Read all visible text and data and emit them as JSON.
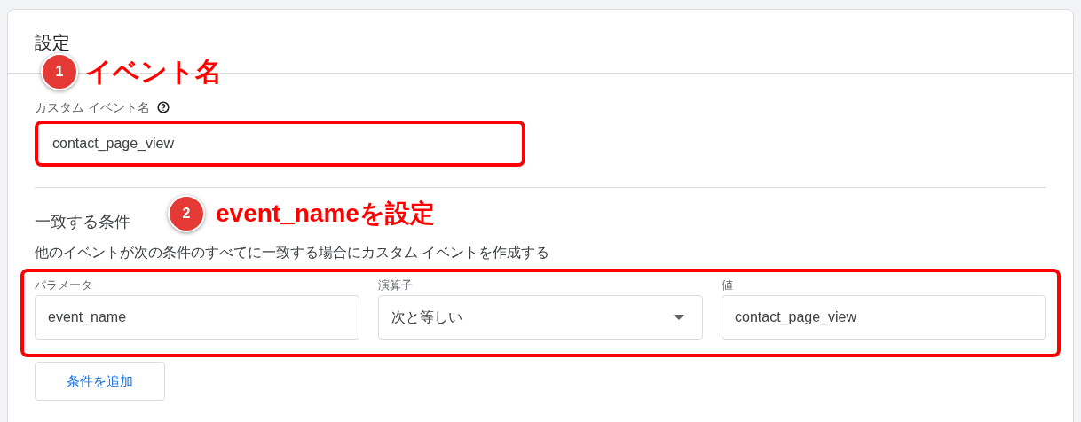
{
  "card": {
    "title": "設定"
  },
  "custom_event": {
    "label": "カスタム イベント名",
    "value": "contact_page_view"
  },
  "conditions": {
    "title": "一致する条件",
    "description": "他のイベントが次の条件のすべてに一致する場合にカスタム イベントを作成する",
    "fields": [
      {
        "kind": "text",
        "label": "パラメータ",
        "value": "event_name"
      },
      {
        "kind": "dropdown",
        "label": "演算子",
        "value": "次と等しい"
      },
      {
        "kind": "text",
        "label": "値",
        "value": "contact_page_view"
      }
    ],
    "add_button": "条件を追加"
  },
  "annotations": [
    {
      "number": "1",
      "text": "イベント名"
    },
    {
      "number": "2",
      "text": "event_nameを設定"
    }
  ]
}
